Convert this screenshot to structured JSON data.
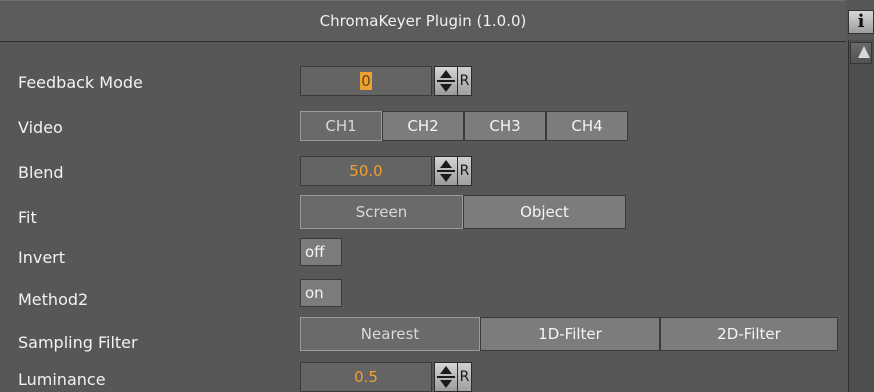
{
  "header": {
    "title": "ChromaKeyer Plugin (1.0.0)",
    "info_label": "i"
  },
  "params": {
    "feedback_mode": {
      "label": "Feedback Mode",
      "value": "0",
      "reset": "R"
    },
    "video": {
      "label": "Video",
      "options": [
        "CH1",
        "CH2",
        "CH3",
        "CH4"
      ],
      "selected": "CH1"
    },
    "blend": {
      "label": "Blend",
      "value": "50.0",
      "reset": "R"
    },
    "fit": {
      "label": "Fit",
      "options": [
        "Screen",
        "Object"
      ],
      "selected": "Screen"
    },
    "invert": {
      "label": "Invert",
      "value": "off"
    },
    "method2": {
      "label": "Method2",
      "value": "on"
    },
    "sampling_filter": {
      "label": "Sampling Filter",
      "options": [
        "Nearest",
        "1D-Filter",
        "2D-Filter"
      ],
      "selected": "Nearest"
    },
    "luminance": {
      "label": "Luminance",
      "value": "0.5",
      "reset": "R"
    }
  },
  "colors": {
    "background": "#575757",
    "value_text": "#f0a030"
  }
}
